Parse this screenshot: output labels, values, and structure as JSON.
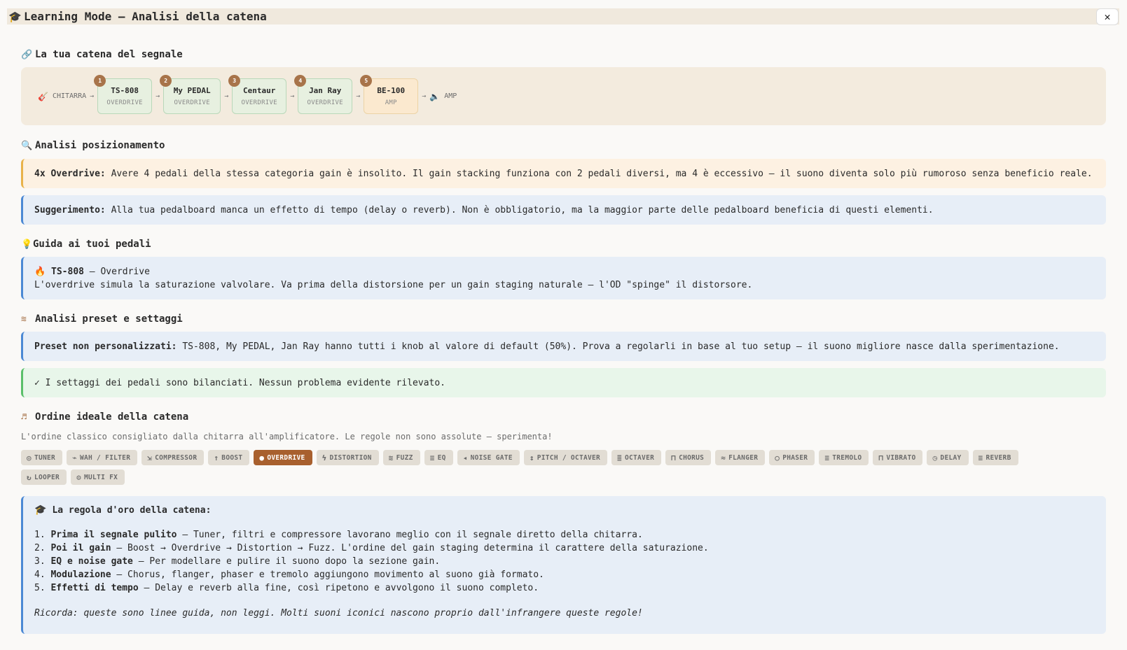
{
  "window": {
    "title": "Learning Mode — Analisi della catena",
    "close_label": "✕"
  },
  "chain_section": {
    "title": "La tua catena del segnale",
    "start_label": "CHITARRA",
    "end_label": "AMP",
    "nodes": [
      {
        "num": "1",
        "name": "TS-808",
        "category": "OVERDRIVE"
      },
      {
        "num": "2",
        "name": "My PEDAL",
        "category": "OVERDRIVE"
      },
      {
        "num": "3",
        "name": "Centaur",
        "category": "OVERDRIVE"
      },
      {
        "num": "4",
        "name": "Jan Ray",
        "category": "OVERDRIVE"
      },
      {
        "num": "5",
        "name": "BE-100",
        "category": "AMP"
      }
    ]
  },
  "positioning": {
    "title": "Analisi posizionamento",
    "warning_label": "4x Overdrive:",
    "warning_text": " Avere 4 pedali della stessa categoria gain è insolito. Il gain stacking funziona con 2 pedali diversi, ma 4 è eccessivo — il suono diventa solo più rumoroso senza beneficio reale.",
    "suggestion_label": "Suggerimento:",
    "suggestion_text": " Alla tua pedalboard manca un effetto di tempo (delay o reverb). Non è obbligatorio, ma la maggior parte delle pedalboard beneficia di questi elementi."
  },
  "guide": {
    "title": "Guida ai tuoi pedali",
    "pedal_name": "TS-808",
    "pedal_type": " — Overdrive",
    "pedal_text": "L'overdrive simula la saturazione valvolare. Va prima della distorsione per un gain staging naturale — l'OD \"spinge\" il distorsore."
  },
  "presets": {
    "title": "Analisi preset e settaggi",
    "info_label": "Preset non personalizzati:",
    "info_text": " TS-808, My PEDAL, Jan Ray hanno tutti i knob al valore di default (50%). Prova a regolarli in base al tuo setup — il suono migliore nasce dalla sperimentazione.",
    "ok_text": "✓ I settaggi dei pedali sono bilanciati. Nessun problema evidente rilevato."
  },
  "order": {
    "title": "Ordine ideale della catena",
    "description": "L'ordine classico consigliato dalla chitarra all'amplificatore. Le regole non sono assolute — sperimenta!",
    "chips": [
      {
        "icon": "◎",
        "label": "TUNER"
      },
      {
        "icon": "⌁",
        "label": "WAH / FILTER"
      },
      {
        "icon": "⇲",
        "label": "COMPRESSOR"
      },
      {
        "icon": "↑",
        "label": "BOOST"
      },
      {
        "icon": "●",
        "label": "OVERDRIVE",
        "active": true
      },
      {
        "icon": "ϟ",
        "label": "DISTORTION"
      },
      {
        "icon": "≋",
        "label": "FUZZ"
      },
      {
        "icon": "≡",
        "label": "EQ"
      },
      {
        "icon": "◂",
        "label": "NOISE GATE"
      },
      {
        "icon": "↕",
        "label": "PITCH / OCTAVER"
      },
      {
        "icon": "≣",
        "label": "OCTAVER"
      },
      {
        "icon": "⊓",
        "label": "CHORUS"
      },
      {
        "icon": "≈",
        "label": "FLANGER"
      },
      {
        "icon": "○",
        "label": "PHASER"
      },
      {
        "icon": "≡",
        "label": "TREMOLO"
      },
      {
        "icon": "⊓",
        "label": "VIBRATO"
      },
      {
        "icon": "◷",
        "label": "DELAY"
      },
      {
        "icon": "≡",
        "label": "REVERB"
      },
      {
        "icon": "↻",
        "label": "LOOPER"
      },
      {
        "icon": "⚙",
        "label": "MULTI FX"
      }
    ]
  },
  "golden_rule": {
    "title": "La regola d'oro della catena:",
    "items": [
      {
        "num": "1.",
        "bold": "Prima il segnale pulito",
        "text": " — Tuner, filtri e compressore lavorano meglio con il segnale diretto della chitarra."
      },
      {
        "num": "2.",
        "bold": "Poi il gain",
        "text": " — Boost → Overdrive → Distortion → Fuzz. L'ordine del gain staging determina il carattere della saturazione."
      },
      {
        "num": "3.",
        "bold": "EQ e noise gate",
        "text": " — Per modellare e pulire il suono dopo la sezione gain."
      },
      {
        "num": "4.",
        "bold": "Modulazione",
        "text": " — Chorus, flanger, phaser e tremolo aggiungono movimento al suono già formato."
      },
      {
        "num": "5.",
        "bold": "Effetti di tempo",
        "text": " — Delay e reverb alla fine, così ripetono e avvolgono il suono completo."
      }
    ],
    "remember": "Ricorda: queste sono linee guida, non leggi. Molti suoni iconici nascono proprio dall'infrangere queste regole!"
  }
}
